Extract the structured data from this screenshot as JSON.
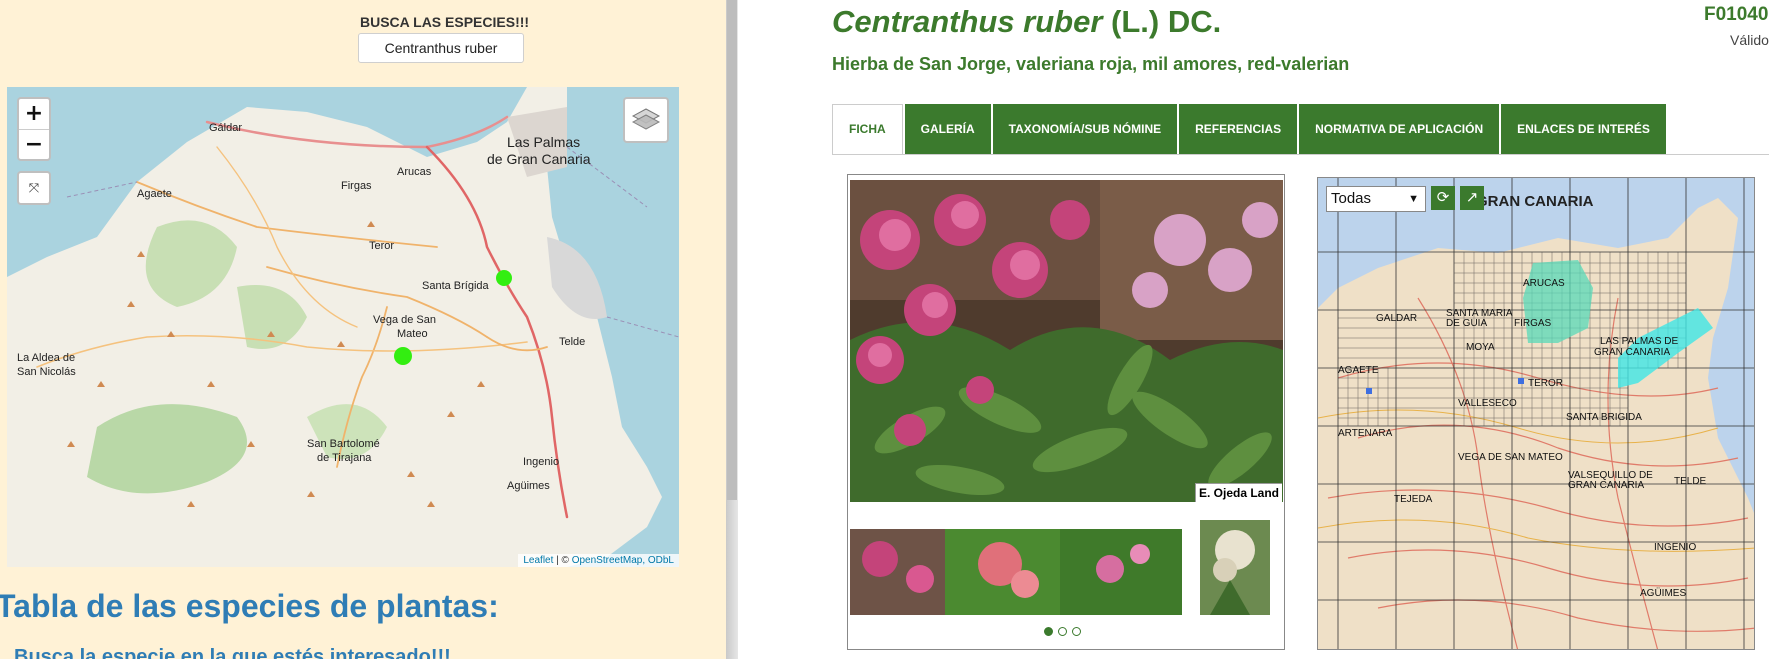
{
  "left": {
    "search_heading": "BUSCA LAS ESPECIES!!!",
    "search_value": "Centranthus ruber",
    "map": {
      "zoom_in": "+",
      "zoom_out": "−",
      "attribution_leaflet": "Leaflet",
      "attribution_sep": " | © ",
      "attribution_osm": "OpenStreetMap, ODbL",
      "places": [
        "Gáldar",
        "Agaete",
        "Arucas",
        "Firgas",
        "Las Palmas",
        "de Gran Canaria",
        "Teror",
        "Santa Brígida",
        "Vega de San",
        "Mateo",
        "Telde",
        "La Aldea de",
        "San Nicolás",
        "San Bartolomé",
        "de Tirajana",
        "Ingenio",
        "Agüimes"
      ],
      "marker_color": "#33ee11"
    },
    "table_title": "Tabla de las especies de plantas:",
    "table_subtitle": "Busca la especie en la que estés interesado!!!"
  },
  "right": {
    "scientific_name": "Centranthus ruber",
    "author": "(L.) DC.",
    "common_names": "Hierba de San Jorge, valeriana roja, mil amores, red-valerian",
    "code": "F01040",
    "status": "Válido",
    "tabs": [
      "FICHA",
      "GALERÍA",
      "TAXONOMÍA/SUB NÓMINE",
      "REFERENCIAS",
      "NORMATIVA DE APLICACIÓN",
      "ENLACES DE INTERÉS"
    ],
    "active_tab": "FICHA",
    "photo_credit": "E. Ojeda Land",
    "carousel_pages": 3,
    "distribution_map": {
      "selected_filter": "Todas",
      "island_title": "GRAN CANARIA",
      "places": [
        "GALDAR",
        "SANTA MARIA",
        "DE GUIA",
        "ARUCAS",
        "FIRGAS",
        "MOYA",
        "LAS PALMAS DE",
        "GRAN CANARIA",
        "AGAETE",
        "TEROR",
        "VALLESECO",
        "SANTA BRIGIDA",
        "ARTENARA",
        "VEGA DE SAN MATEO",
        "VALSEQUILLO DE",
        "GRAN CANARIA",
        "TELDE",
        "TEJEDA",
        "INGENIO",
        "AGÜIMES"
      ]
    }
  },
  "colors": {
    "accent_green": "#3b7a2d",
    "link_blue": "#2f7db5",
    "left_bg": "#fff2d6"
  }
}
